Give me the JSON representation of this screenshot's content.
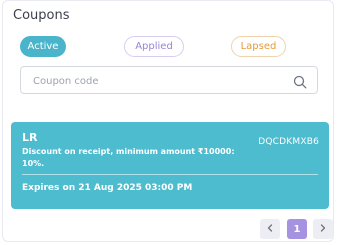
{
  "panel": {
    "title": "Coupons"
  },
  "filters": {
    "active_label": "Active",
    "applied_label": "Applied",
    "lapsed_label": "Lapsed"
  },
  "search": {
    "placeholder": "Coupon code",
    "value": ""
  },
  "coupon": {
    "code": "LR",
    "id": "DQCDKMXB6",
    "description": "Discount on receipt, minimum amount ₹10000: 10%.",
    "expiry": "Expires on 21 Aug 2025 03:00 PM"
  },
  "pagination": {
    "current_page": "1",
    "prev_icon": "chevron-left-icon",
    "next_icon": "chevron-right-icon"
  },
  "colors": {
    "accent": "#4ebccf",
    "page_active": "#a592e0",
    "applied": "#9b83d4",
    "lapsed": "#e59a3a"
  }
}
